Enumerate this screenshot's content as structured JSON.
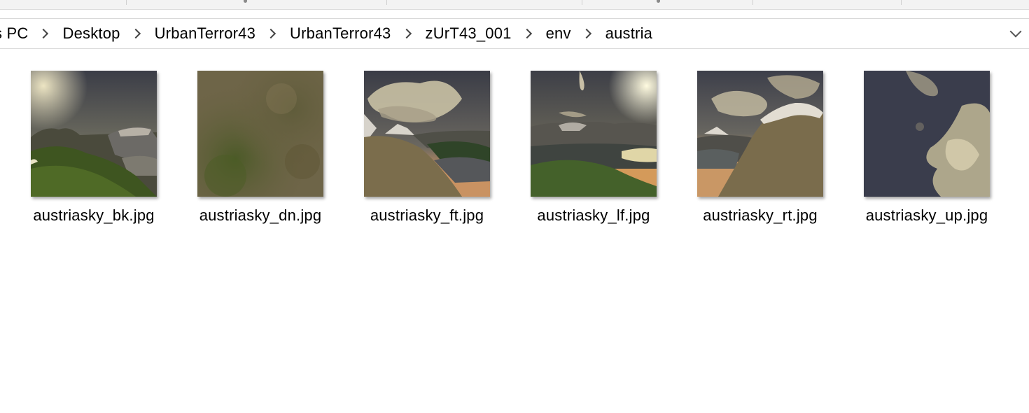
{
  "breadcrumbs": [
    "s PC",
    "Desktop",
    "UrbanTerror43",
    "UrbanTerror43",
    "zUrT43_001",
    "env",
    "austria"
  ],
  "files": [
    {
      "name": "austriasky_bk.jpg",
      "thumb": "sky-back-icon"
    },
    {
      "name": "austriasky_dn.jpg",
      "thumb": "grass-ground-icon"
    },
    {
      "name": "austriasky_ft.jpg",
      "thumb": "sky-front-icon"
    },
    {
      "name": "austriasky_lf.jpg",
      "thumb": "sky-left-icon"
    },
    {
      "name": "austriasky_rt.jpg",
      "thumb": "sky-right-icon"
    },
    {
      "name": "austriasky_up.jpg",
      "thumb": "sky-up-icon"
    }
  ],
  "colors": {
    "background": "#ffffff",
    "border": "#d9d9d9",
    "ribbon": "#f3f3f3"
  }
}
